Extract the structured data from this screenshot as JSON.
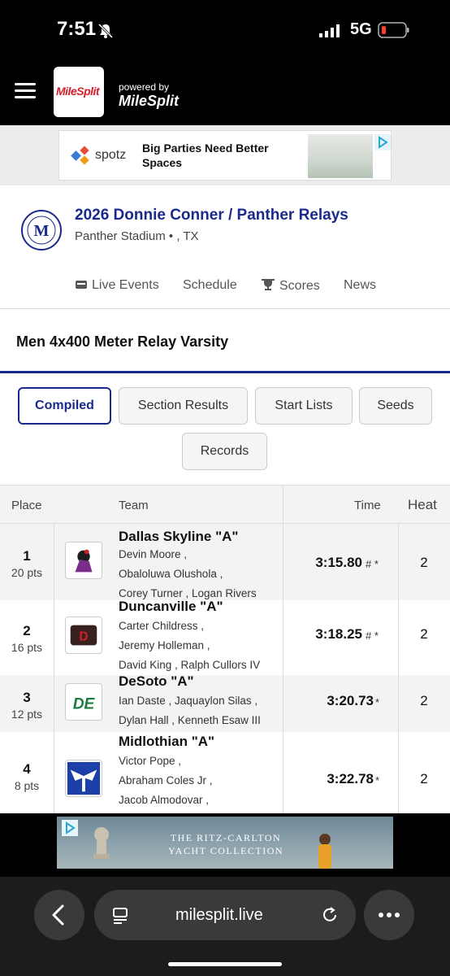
{
  "status": {
    "time": "7:51",
    "network": "5G"
  },
  "header": {
    "logo": "MileSplit",
    "powered_by": "powered by",
    "powered_logo": "MileSplit"
  },
  "ad_top": {
    "brand": "spotz",
    "headline": "Big Parties Need Better Spaces"
  },
  "meet": {
    "title": "2026 Donnie Conner / Panther Relays",
    "location": "Panther Stadium • , TX"
  },
  "nav": [
    {
      "label": "Live Events",
      "icon": "live-icon"
    },
    {
      "label": "Schedule"
    },
    {
      "label": "Scores",
      "icon": "trophy-icon"
    },
    {
      "label": "News"
    }
  ],
  "event": {
    "title": "Men 4x400 Meter Relay Varsity"
  },
  "filters": {
    "compiled": "Compiled",
    "section_results": "Section Results",
    "start_lists": "Start Lists",
    "seeds": "Seeds",
    "records": "Records"
  },
  "table": {
    "headers": {
      "place": "Place",
      "team": "Team",
      "time": "Time",
      "heat": "Heat"
    },
    "rows": [
      {
        "place": "1",
        "pts": "20 pts",
        "team": "Dallas Skyline \"A\"",
        "runners": [
          "Devin Moore ,",
          "Obaloluwa Olushola ,",
          "Corey Turner , Logan Rivers"
        ],
        "time": "3:15.80",
        "mark": "# *",
        "heat": "2"
      },
      {
        "place": "2",
        "pts": "16 pts",
        "team": "Duncanville \"A\"",
        "runners": [
          "Carter Childress ,",
          "Jeremy Holleman ,",
          "David King , Ralph Cullors IV"
        ],
        "time": "3:18.25",
        "mark": "# *",
        "heat": "2"
      },
      {
        "place": "3",
        "pts": "12 pts",
        "team": "DeSoto \"A\"",
        "runners": [
          "Ian Daste , Jaquaylon Silas ,",
          "Dylan Hall , Kenneth Esaw III"
        ],
        "time": "3:20.73",
        "mark": "*",
        "heat": "2"
      },
      {
        "place": "4",
        "pts": "8 pts",
        "team": "Midlothian \"A\"",
        "runners": [
          "Victor Pope ,",
          "Abraham Coles Jr ,",
          "Jacob Almodovar ,"
        ],
        "time": "3:22.78",
        "mark": "*",
        "heat": "2"
      }
    ]
  },
  "ad_bottom": {
    "line1": "THE RITZ-CARLTON",
    "line2": "YACHT COLLECTION"
  },
  "browser": {
    "url": "milesplit.live"
  },
  "colors": {
    "brand_navy": "#1a2a8c",
    "milesplit_red": "#d21f2b"
  }
}
